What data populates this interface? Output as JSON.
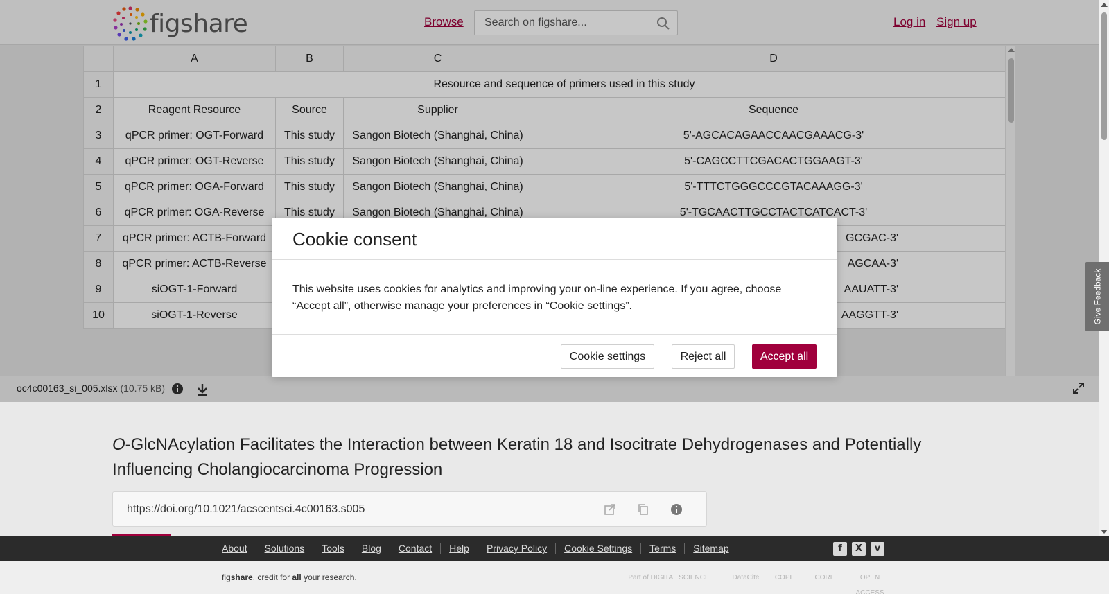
{
  "header": {
    "logo_text": "figshare",
    "browse_label": "Browse",
    "search_placeholder": "Search on figshare...",
    "login_label": "Log in",
    "signup_label": "Sign up"
  },
  "sheet": {
    "columns": [
      "A",
      "B",
      "C",
      "D"
    ],
    "rows": [
      {
        "num": "1",
        "merged": "Resource and sequence of primers used in this study"
      },
      {
        "num": "2",
        "a": "Reagent Resource",
        "b": "Source",
        "c": "Supplier",
        "d": "Sequence"
      },
      {
        "num": "3",
        "a": "qPCR primer: OGT-Forward",
        "b": "This study",
        "c": "Sangon Biotech (Shanghai, China)",
        "d": "5'-AGCACAGAACCAACGAAACG-3'"
      },
      {
        "num": "4",
        "a": "qPCR primer: OGT-Reverse",
        "b": "This study",
        "c": "Sangon Biotech (Shanghai, China)",
        "d": "5'-CAGCCTTCGACACTGGAAGT-3'"
      },
      {
        "num": "5",
        "a": "qPCR primer: OGA-Forward",
        "b": "This study",
        "c": "Sangon Biotech (Shanghai, China)",
        "d": "5'-TTTCTGGGCCCGTACAAAGG-3'"
      },
      {
        "num": "6",
        "a": "qPCR primer: OGA-Reverse",
        "b": "This study",
        "c": "Sangon Biotech (Shanghai, China)",
        "d": "5'-TGCAACTTGCCTACTCATCACT-3'"
      },
      {
        "num": "7",
        "a": "qPCR primer: ACTB-Forward",
        "b": "",
        "c": "",
        "d": "GCGAC-3'"
      },
      {
        "num": "8",
        "a": "qPCR primer: ACTB-Reverse",
        "b": "",
        "c": "",
        "d": "AGCAA-3'"
      },
      {
        "num": "9",
        "a": "siOGT-1-Forward",
        "b": "",
        "c": "",
        "d": "AAUATT-3'"
      },
      {
        "num": "10",
        "a": "siOGT-1-Reverse",
        "b": "",
        "c": "",
        "d": "AAGGTT-3'"
      }
    ]
  },
  "filebar": {
    "filename": "oc4c00163_si_005.xlsx",
    "filesize": "(10.75 kB)"
  },
  "article": {
    "title_italic": "O",
    "title_rest": "-GlcNAcylation Facilitates the Interaction between Keratin 18 and Isocitrate Dehydrogenases and Potentially Influencing Cholangiocarcinoma Progression",
    "doi": "https://doi.org/10.1021/acscentsci.4c00163.s005"
  },
  "feedback_label": "Give Feedback",
  "cookie": {
    "title": "Cookie consent",
    "body": "This website uses cookies for analytics and improving your on-line experience. If you agree, choose “Accept all”, otherwise manage your preferences in “Cookie settings”.",
    "settings_label": "Cookie settings",
    "reject_label": "Reject all",
    "accept_label": "Accept all"
  },
  "footer": {
    "links": [
      "About",
      "Solutions",
      "Tools",
      "Blog",
      "Contact",
      "Help",
      "Privacy Policy",
      "Cookie Settings",
      "Terms",
      "Sitemap"
    ],
    "tagline_pre": "fig",
    "tagline_bold": "share",
    "tagline_mid": ". credit for ",
    "tagline_bold2": "all",
    "tagline_post": " your research.",
    "partners": [
      "Part of DIGITAL SCIENCE",
      "DataCite",
      "COPE",
      "CORE",
      "OPEN ACCESS"
    ]
  },
  "colors": {
    "brand": "#a0003c",
    "footer_bg": "#2b2b2b"
  }
}
